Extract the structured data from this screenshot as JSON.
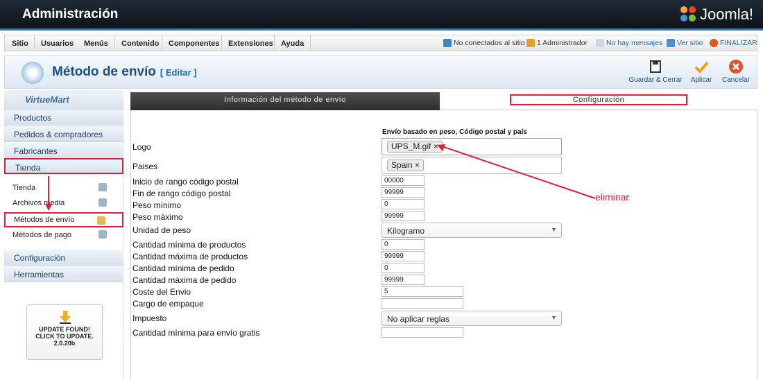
{
  "header": {
    "title": "Administración",
    "brand": "Joomla!"
  },
  "menubar": {
    "items": [
      "Sitio",
      "Usuarios",
      "Menús",
      "Contenido",
      "Componentes",
      "Extensiones",
      "Ayuda"
    ],
    "status": {
      "visitors": "No conectados al sitio",
      "admins": "1 Administrador",
      "messages": "No hay mensajes",
      "view": "Ver sitio",
      "logout": "FINALIZAR"
    }
  },
  "toolbar": {
    "title": "Método de envío",
    "edit": "[ Editar ]",
    "save_close": "Guardar & Cerrar",
    "apply": "Aplicar",
    "cancel": "Cancelar"
  },
  "sidebar": {
    "logo": "VirtueMart",
    "sections": [
      "Productos",
      "Pedidos & compradores",
      "Fabricantes",
      "Tienda",
      "Configuración",
      "Herramientas"
    ],
    "tienda_items": [
      "Tienda",
      "Archivos media",
      "Métodos de envío",
      "Métodos de pago"
    ],
    "update": {
      "line1": "UPDATE FOUND!",
      "line2": "CLICK TO UPDATE.",
      "version": "2.0.20b"
    }
  },
  "tabs": {
    "info": "Información del método de envío",
    "config": "Configuración"
  },
  "form": {
    "heading": "Envío basado en peso, Código postal y país",
    "labels": {
      "logo": "Logo",
      "countries": "Paises",
      "zip_start": "Inicio de rango código postal",
      "zip_end": "Fin de rango código postal",
      "weight_min": "Peso mínimo",
      "weight_max": "Peso máximo",
      "weight_unit": "Unidad de peso",
      "qty_min": "Cantidad mínima de productos",
      "qty_max": "Cantidad máxima de productos",
      "order_min": "Cantidad mínima de pedido",
      "order_max": "Cantidad máxima de pedido",
      "cost": "Coste del Envio",
      "packing": "Cargo de empaque",
      "tax": "Impuesto",
      "free_min": "Cantidad mínima para envío gratis"
    },
    "values": {
      "logo": "UPS_M.gif",
      "country": "Spain",
      "zip_start": "00000",
      "zip_end": "99999",
      "weight_min": "0",
      "weight_max": "99999",
      "weight_unit": "Kilogramo",
      "qty_min": "0",
      "qty_max": "99999",
      "order_min": "0",
      "order_max": "99999",
      "cost": "5",
      "packing": "",
      "tax": "No aplicar reglas",
      "free_min": ""
    }
  },
  "annotation": "eliminar"
}
